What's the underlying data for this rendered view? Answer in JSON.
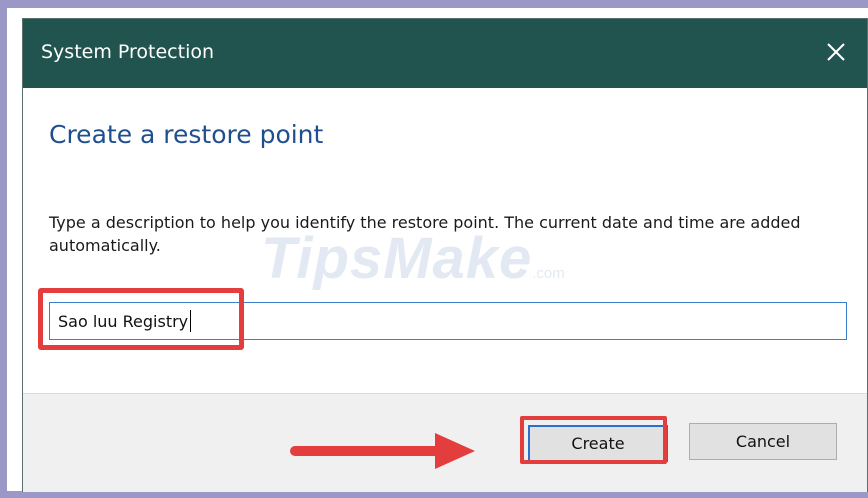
{
  "window": {
    "title": "System Protection",
    "close_icon": "close-icon"
  },
  "content": {
    "heading": "Create a restore point",
    "description": "Type a description to help you identify the restore point. The current date and time are added automatically.",
    "input_value": "Sao luu Registry"
  },
  "buttons": {
    "create_label": "Create",
    "cancel_label": "Cancel"
  },
  "watermark": {
    "brand": "TipsMake",
    "suffix": ".com"
  },
  "colors": {
    "titlebar": "#21544f",
    "heading": "#1f4f8f",
    "highlight": "#e33d3d",
    "frame": "#9b98c8"
  }
}
